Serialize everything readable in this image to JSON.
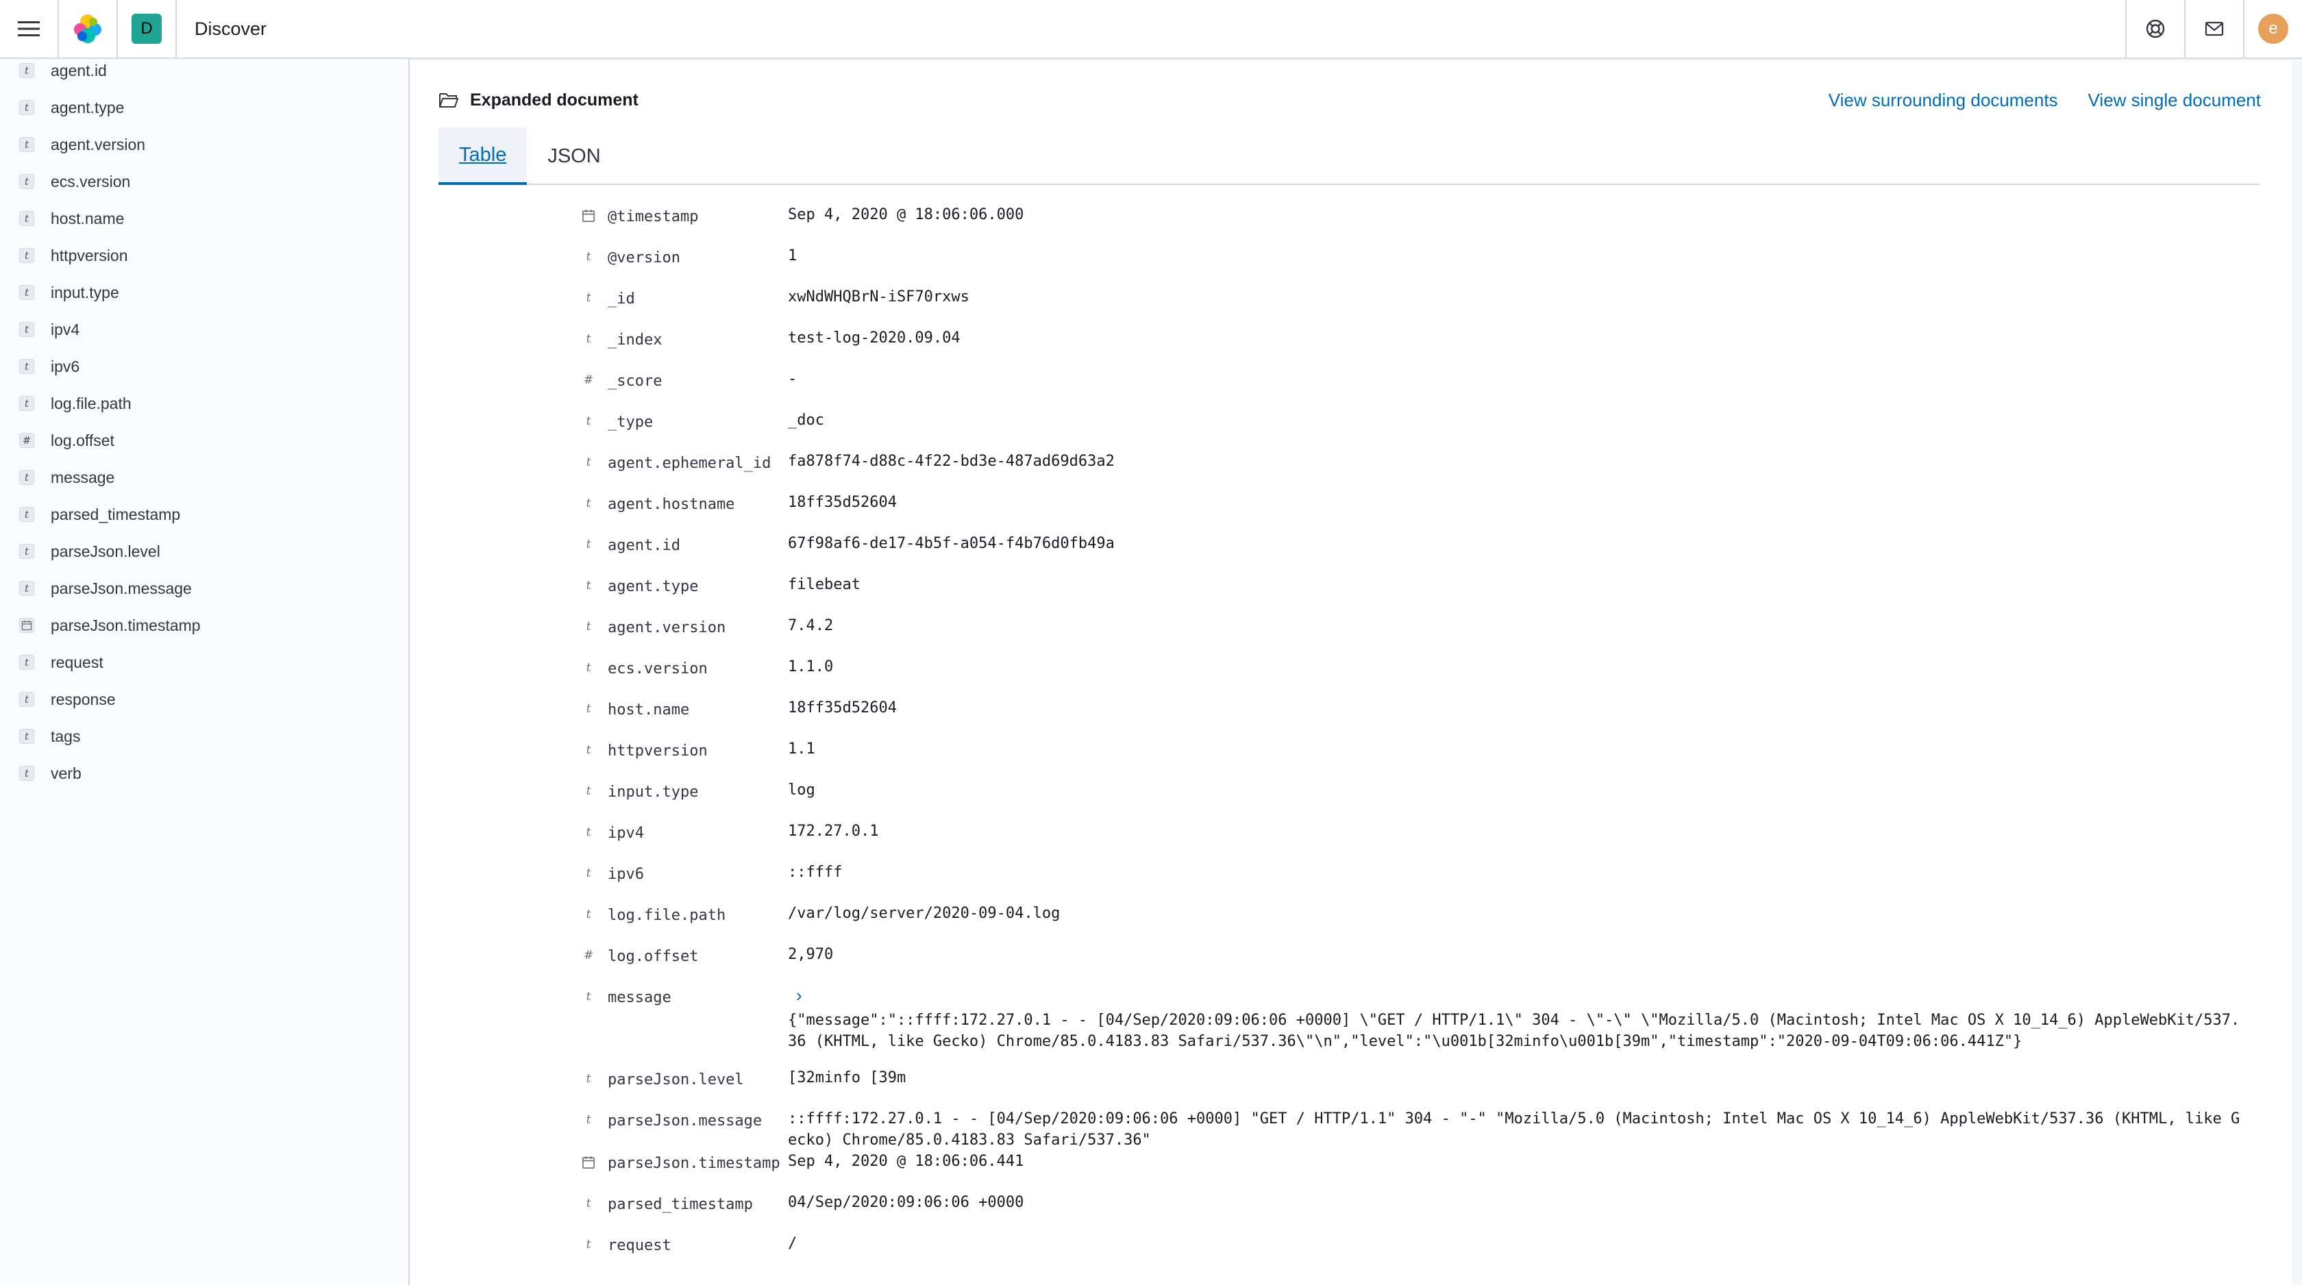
{
  "header": {
    "title": "Discover",
    "space_initial": "D",
    "avatar_initial": "e",
    "icons": [
      "menu-icon",
      "elastic-logo",
      "help-icon",
      "mail-icon"
    ]
  },
  "sidebar": {
    "fields": [
      {
        "type": "t",
        "name": "agent.id"
      },
      {
        "type": "t",
        "name": "agent.type"
      },
      {
        "type": "t",
        "name": "agent.version"
      },
      {
        "type": "t",
        "name": "ecs.version"
      },
      {
        "type": "t",
        "name": "host.name"
      },
      {
        "type": "t",
        "name": "httpversion"
      },
      {
        "type": "t",
        "name": "input.type"
      },
      {
        "type": "t",
        "name": "ipv4"
      },
      {
        "type": "t",
        "name": "ipv6"
      },
      {
        "type": "t",
        "name": "log.file.path"
      },
      {
        "type": "#",
        "name": "log.offset"
      },
      {
        "type": "t",
        "name": "message"
      },
      {
        "type": "t",
        "name": "parsed_timestamp"
      },
      {
        "type": "t",
        "name": "parseJson.level"
      },
      {
        "type": "t",
        "name": "parseJson.message"
      },
      {
        "type": "date",
        "name": "parseJson.timestamp"
      },
      {
        "type": "t",
        "name": "request"
      },
      {
        "type": "t",
        "name": "response"
      },
      {
        "type": "t",
        "name": "tags"
      },
      {
        "type": "t",
        "name": "verb"
      }
    ]
  },
  "document": {
    "title": "Expanded document",
    "link_surrounding": "View surrounding documents",
    "link_single": "View single document",
    "tabs": [
      "Table",
      "JSON"
    ],
    "rows": [
      {
        "type": "date",
        "key": "@timestamp",
        "value": "Sep 4, 2020 @ 18:06:06.000"
      },
      {
        "type": "t",
        "key": "@version",
        "value": "1"
      },
      {
        "type": "t",
        "key": "_id",
        "value": "xwNdWHQBrN-iSF70rxws"
      },
      {
        "type": "t",
        "key": "_index",
        "value": "test-log-2020.09.04"
      },
      {
        "type": "#",
        "key": "_score",
        "value": " -"
      },
      {
        "type": "t",
        "key": "_type",
        "value": "_doc"
      },
      {
        "type": "t",
        "key": "agent.ephemeral_id",
        "value": "fa878f74-d88c-4f22-bd3e-487ad69d63a2"
      },
      {
        "type": "t",
        "key": "agent.hostname",
        "value": "18ff35d52604"
      },
      {
        "type": "t",
        "key": "agent.id",
        "value": "67f98af6-de17-4b5f-a054-f4b76d0fb49a"
      },
      {
        "type": "t",
        "key": "agent.type",
        "value": "filebeat"
      },
      {
        "type": "t",
        "key": "agent.version",
        "value": "7.4.2"
      },
      {
        "type": "t",
        "key": "ecs.version",
        "value": "1.1.0"
      },
      {
        "type": "t",
        "key": "host.name",
        "value": "18ff35d52604"
      },
      {
        "type": "t",
        "key": "httpversion",
        "value": "1.1"
      },
      {
        "type": "t",
        "key": "input.type",
        "value": "log"
      },
      {
        "type": "t",
        "key": "ipv4",
        "value": "172.27.0.1"
      },
      {
        "type": "t",
        "key": "ipv6",
        "value": "::ffff"
      },
      {
        "type": "t",
        "key": "log.file.path",
        "value": "/var/log/server/2020-09-04.log"
      },
      {
        "type": "#",
        "key": "log.offset",
        "value": "2,970"
      },
      {
        "type": "t",
        "key": "message",
        "value": "{\"message\":\"::ffff:172.27.0.1 - - [04/Sep/2020:09:06:06 +0000] \\\"GET / HTTP/1.1\\\" 304 - \\\"-\\\" \\\"Mozilla/5.0 (Macintosh; Intel Mac OS X 10_14_6) AppleWebKit/537.36 (KHTML, like Gecko) Chrome/85.0.4183.83 Safari/537.36\\\"\\n\",\"level\":\"\\u001b[32minfo\\u001b[39m\",\"timestamp\":\"2020-09-04T09:06:06.441Z\"}",
        "expandable": true
      },
      {
        "type": "t",
        "key": "parseJson.level",
        "value": " [32minfo [39m"
      },
      {
        "type": "t",
        "key": "parseJson.message",
        "value": "::ffff:172.27.0.1 - - [04/Sep/2020:09:06:06 +0000] \"GET / HTTP/1.1\" 304 - \"-\" \"Mozilla/5.0 (Macintosh; Intel Mac OS X 10_14_6) AppleWebKit/537.36 (KHTML, like Gecko) Chrome/85.0.4183.83 Safari/537.36\""
      },
      {
        "type": "date",
        "key": "parseJson.timestamp",
        "value": "Sep 4, 2020 @ 18:06:06.441"
      },
      {
        "type": "t",
        "key": "parsed_timestamp",
        "value": "04/Sep/2020:09:06:06 +0000"
      },
      {
        "type": "t",
        "key": "request",
        "value": "/"
      }
    ]
  }
}
